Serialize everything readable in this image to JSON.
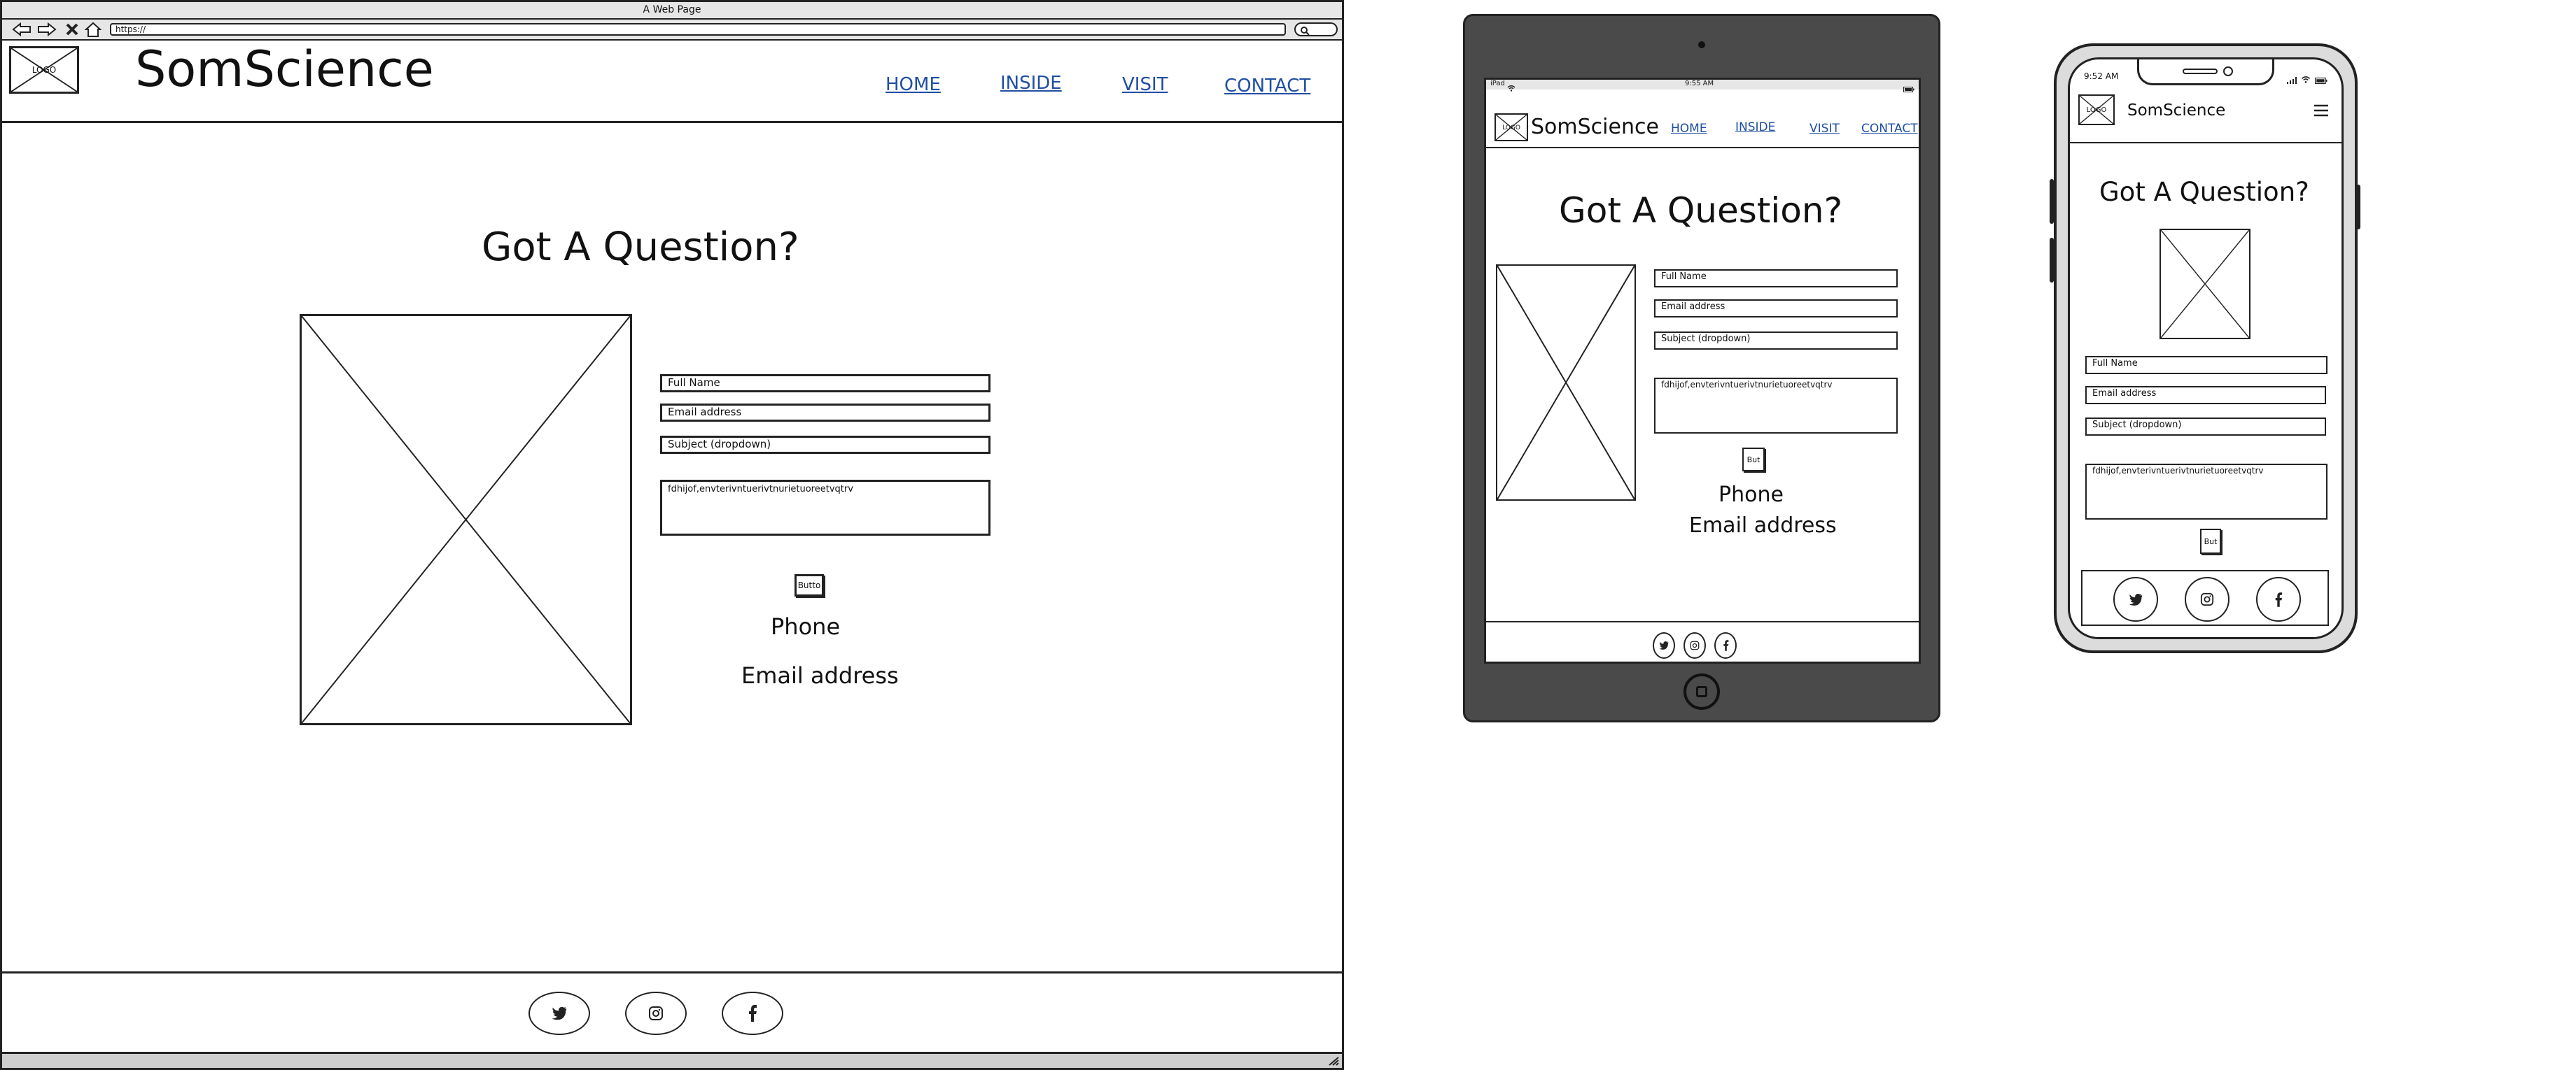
{
  "desktop": {
    "window_title": "A Web Page",
    "url": "https://",
    "logo": "LOGO",
    "brand": "SomScience",
    "nav": [
      "HOME",
      "INSIDE",
      "VISIT",
      "CONTACT"
    ],
    "heading": "Got A Question?",
    "fields": {
      "name": "Full Name",
      "email": "Email address",
      "subject": "Subject (dropdown)",
      "message": "fdhijof,envterivntuerivtnurietuoreetvqtrv"
    },
    "button": "Butto",
    "phone": "Phone",
    "email_label": "Email address"
  },
  "tablet": {
    "status_left": "iPad",
    "status_time": "9:55 AM",
    "logo": "LOGO",
    "brand": "SomScience",
    "nav": [
      "HOME",
      "INSIDE",
      "VISIT",
      "CONTACT"
    ],
    "heading": "Got A Question?",
    "fields": {
      "name": "Full Name",
      "email": "Email address",
      "subject": "Subject (dropdown)",
      "message": "fdhijof,envterivntuerivtnurietuoreetvqtrv"
    },
    "button": "But",
    "phone": "Phone",
    "email_label": "Email address"
  },
  "phone": {
    "status_time": "9:52 AM",
    "logo": "LOGO",
    "brand": "SomScience",
    "heading": "Got A Question?",
    "fields": {
      "name": "Full Name",
      "email": "Email address",
      "subject": "Subject (dropdown)",
      "message": "fdhijof,envterivntuerivtnurietuoreetvqtrv"
    },
    "button": "But"
  },
  "icons": [
    "back-arrow-icon",
    "forward-arrow-icon",
    "close-icon",
    "home-icon",
    "search-icon",
    "twitter-icon",
    "instagram-icon",
    "facebook-icon",
    "hamburger-menu-icon",
    "wifi-icon",
    "battery-icon",
    "signal-icon"
  ]
}
